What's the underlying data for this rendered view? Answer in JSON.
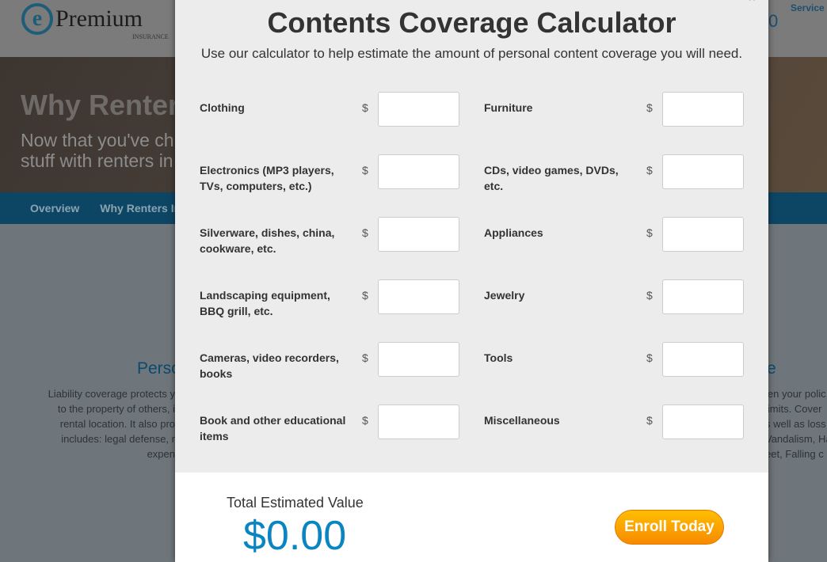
{
  "site": {
    "logo_text": "Premium",
    "logo_sub": "INSURANCE",
    "service_link": "Service P",
    "header_fragment": "0",
    "hero_title": "Why Renters",
    "hero_sub_1": "Now that you've ch",
    "hero_sub_2": "stuff with renters in",
    "nav": [
      "Overview",
      "Why Renters Ins"
    ],
    "left_section": {
      "title": "Perso",
      "lines": [
        "Liability coverage protects y",
        "to the property of others, i",
        "rental location. It also pro",
        "includes: legal defense, r",
        "expen"
      ]
    },
    "right_section": {
      "title": "e",
      "lines": [
        "len your polic",
        "limits. Cover",
        "s well as loss",
        "Vandalism, Ha",
        "eet, Falling c"
      ]
    }
  },
  "modal": {
    "close": "×",
    "title": "Contents Coverage Calculator",
    "subtitle": "Use our calculator to help estimate the amount of personal content coverage you will need.",
    "currency": "$",
    "fields": [
      {
        "label": "Clothing",
        "value": ""
      },
      {
        "label": "Furniture",
        "value": ""
      },
      {
        "label": "Electronics (MP3 players, TVs, computers, etc.)",
        "value": ""
      },
      {
        "label": "CDs, video games, DVDs, etc.",
        "value": ""
      },
      {
        "label": "Silverware, dishes, china, cookware, etc.",
        "value": ""
      },
      {
        "label": "Appliances",
        "value": ""
      },
      {
        "label": "Landscaping equipment, BBQ grill, etc.",
        "value": ""
      },
      {
        "label": "Jewelry",
        "value": ""
      },
      {
        "label": "Cameras, video recorders, books",
        "value": ""
      },
      {
        "label": "Tools",
        "value": ""
      },
      {
        "label": "Book and other educational items",
        "value": ""
      },
      {
        "label": "Miscellaneous",
        "value": ""
      }
    ],
    "total_label": "Total Estimated Value",
    "total_value": "$0.00",
    "enroll_label": "Enroll Today"
  },
  "colors": {
    "accent": "#0a85c0",
    "button": "#f88a00",
    "nav": "#0d4664"
  }
}
